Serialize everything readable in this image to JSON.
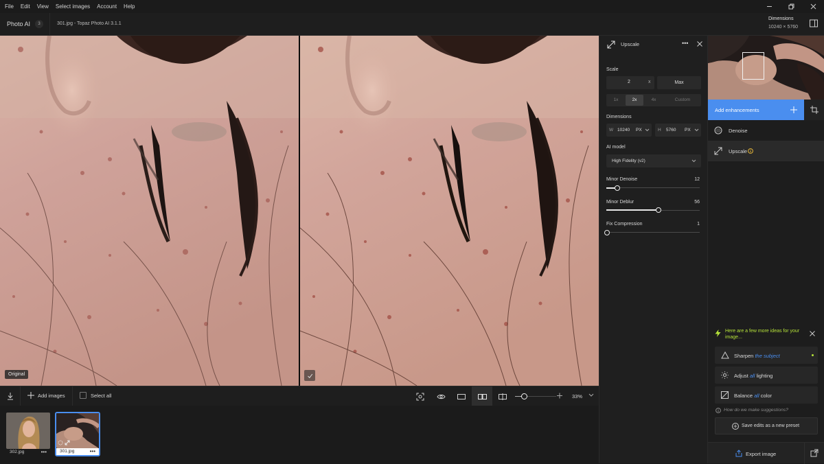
{
  "menu": [
    "File",
    "Edit",
    "View",
    "Select images",
    "Account",
    "Help"
  ],
  "window_controls": {
    "minimize": "minimize-icon",
    "restore": "restore-icon",
    "close": "close-icon"
  },
  "titlebar": {
    "app_name": "Photo AI",
    "badge": "3",
    "document_title": "301.jpg - Topaz Photo AI 3.1.1",
    "dimensions_label": "Dimensions",
    "dimensions_value": "10240 × 5760"
  },
  "canvas": {
    "left_tag": "Original",
    "right_tag_icon": "check-icon"
  },
  "bottombar": {
    "add_images": "Add images",
    "select_all": "Select all",
    "zoom": "33%",
    "zoom_level": 0.1
  },
  "filmstrip": [
    {
      "name": "302.jpg",
      "menu": "•••",
      "selected": false
    },
    {
      "name": "301.jpg",
      "menu": "•••",
      "selected": true
    }
  ],
  "settings": {
    "title": "Upscale",
    "menu": "•••",
    "scale_label": "Scale",
    "scale_value": "2",
    "scale_unit": "x",
    "max_label": "Max",
    "scale_options": [
      "1x",
      "2x",
      "4x",
      "Custom"
    ],
    "scale_selected": "2x",
    "dimensions_label": "Dimensions",
    "width_prefix": "W",
    "width_value": "10240",
    "width_unit": "PX",
    "height_prefix": "H",
    "height_value": "5760",
    "height_unit": "PX",
    "ai_model_label": "AI model",
    "ai_model_value": "High Fidelity (v2)",
    "sliders": [
      {
        "label": "Minor Denoise",
        "value": "12",
        "fraction": 0.12
      },
      {
        "label": "Minor Deblur",
        "value": "56",
        "fraction": 0.56
      },
      {
        "label": "Fix Compression",
        "value": "1",
        "fraction": 0.01
      }
    ]
  },
  "rightpanel": {
    "add_enhancements": "Add enhancements",
    "enhancements": [
      {
        "label": "Denoise",
        "icon": "denoise-icon"
      },
      {
        "label": "Upscale",
        "icon": "upscale-icon",
        "info_icon": "info-icon"
      }
    ],
    "ideas_text": "Here are a few more ideas for your image...",
    "suggestions": [
      {
        "pre": "Sharpen ",
        "hl": "the subject",
        "post": "",
        "icon": "triangle-icon"
      },
      {
        "pre": "Adjust ",
        "hl": "all",
        "post": " lighting",
        "icon": "light-icon"
      },
      {
        "pre": "Balance ",
        "hl": "all",
        "post": " color",
        "icon": "color-balance-icon"
      }
    ],
    "how_text": "How do we make suggestions?",
    "save_preset": "Save edits as a new preset",
    "export": "Export image"
  },
  "colors": {
    "accent": "#4a8eef",
    "lightning": "#b6e33a"
  }
}
